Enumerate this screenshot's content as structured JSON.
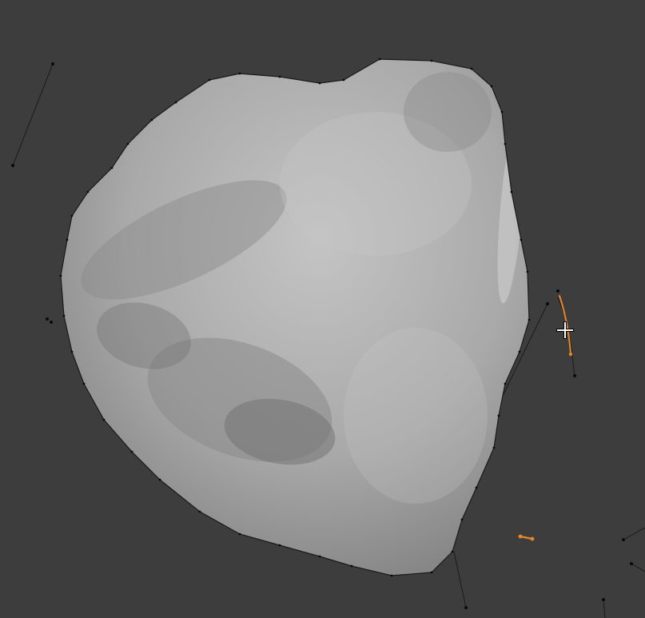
{
  "viewport": {
    "background": "#3d3d3d",
    "object": {
      "kind": "triangulated-mesh",
      "display": "solid-with-wireframe-overlay",
      "solid_color": "#a8a8a8",
      "shadow_color": "#8a8a8a",
      "highlight_color": "#c6c6c6",
      "edge_color": "#111111",
      "vertex_color": "#0a0a0a"
    },
    "selection_color": "#e8862a",
    "cursor_icon": "3d-cursor-icon"
  }
}
